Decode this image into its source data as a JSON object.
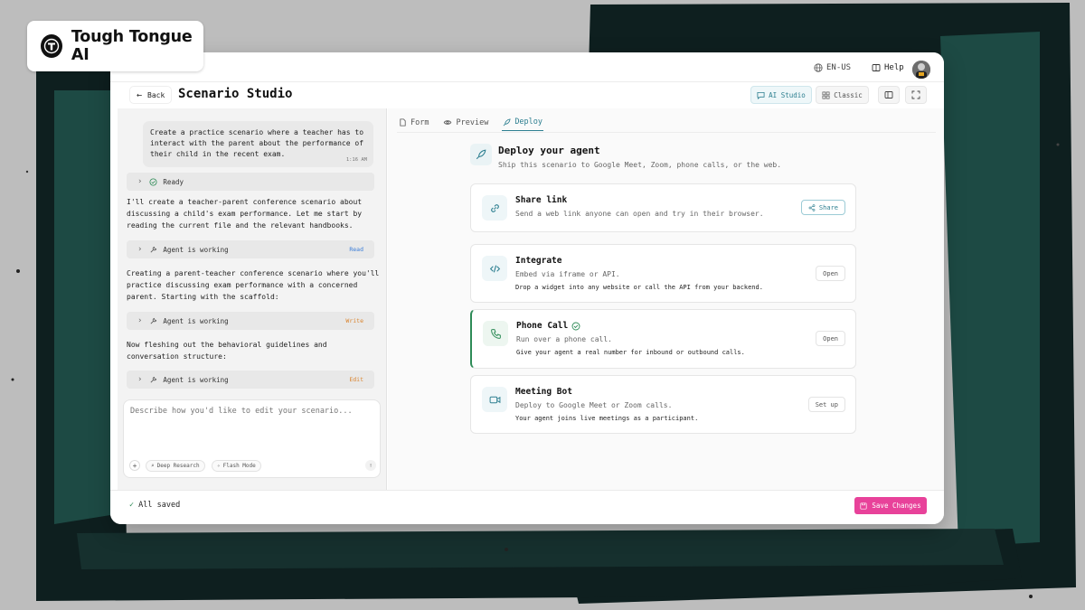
{
  "brand": {
    "name": "Tough Tongue AI"
  },
  "topbar": {
    "language": "EN-US",
    "help": "Help"
  },
  "header": {
    "back_label": "Back",
    "title": "Scenario Studio",
    "ai_studio_label": "AI Studio",
    "classic_label": "Classic"
  },
  "chat": {
    "user_message": "Create a practice scenario where a teacher has to interact with the parent about the performance of their child in the recent exam.",
    "user_time": "1:16 AM",
    "ready_label": "Ready",
    "messages": [
      "I'll create a teacher-parent conference scenario about discussing a child's exam performance. Let me start by reading the current file and the relevant handbooks.",
      "Creating a parent-teacher conference scenario where you'll practice discussing exam performance with a concerned parent. Starting with the scaffold:",
      "Now fleshing out the behavioral guidelines and conversation structure:"
    ],
    "steps": [
      {
        "label": "Agent is working",
        "tag": "Read",
        "tag_color": "#3b7dd8"
      },
      {
        "label": "Agent is working",
        "tag": "Write",
        "tag_color": "#d9822b"
      },
      {
        "label": "Agent is working",
        "tag": "Edit",
        "tag_color": "#d9822b"
      }
    ],
    "composer_placeholder": "Describe how you'd like to edit your scenario...",
    "deep_research": "Deep Research",
    "flash_mode": "Flash Mode"
  },
  "tabs": [
    "Form",
    "Preview",
    "Deploy"
  ],
  "active_tab": "Deploy",
  "deploy": {
    "title": "Deploy your agent",
    "subtitle": "Ship this scenario to Google Meet, Zoom, phone calls, or the web.",
    "cards": [
      {
        "title": "Share link",
        "line1": "Send a web link anyone can open and try in their browser.",
        "line2": "",
        "button": "Share",
        "icon": "link-icon"
      },
      {
        "title": "Integrate",
        "line1": "Embed via iframe or API.",
        "line2": "Drop a widget into any website or call the API from your backend.",
        "button": "Open",
        "icon": "code-icon"
      },
      {
        "title": "Phone Call",
        "line1": "Run over a phone call.",
        "line2": "Give your agent a real number for inbound or outbound calls.",
        "button": "Open",
        "icon": "phone-icon",
        "selected": true
      },
      {
        "title": "Meeting Bot",
        "line1": "Deploy to Google Meet or Zoom calls.",
        "line2": "Your agent joins live meetings as a participant.",
        "button": "Set up",
        "icon": "video-icon"
      }
    ]
  },
  "footer": {
    "saved": "All saved",
    "save_button": "Save Changes"
  },
  "colors": {
    "accent": "#2d7f90",
    "save": "#e8429a",
    "selected": "#2e8b57",
    "backdrop_teal": "#1d4a44",
    "backdrop_dark": "#0e1f1f"
  }
}
